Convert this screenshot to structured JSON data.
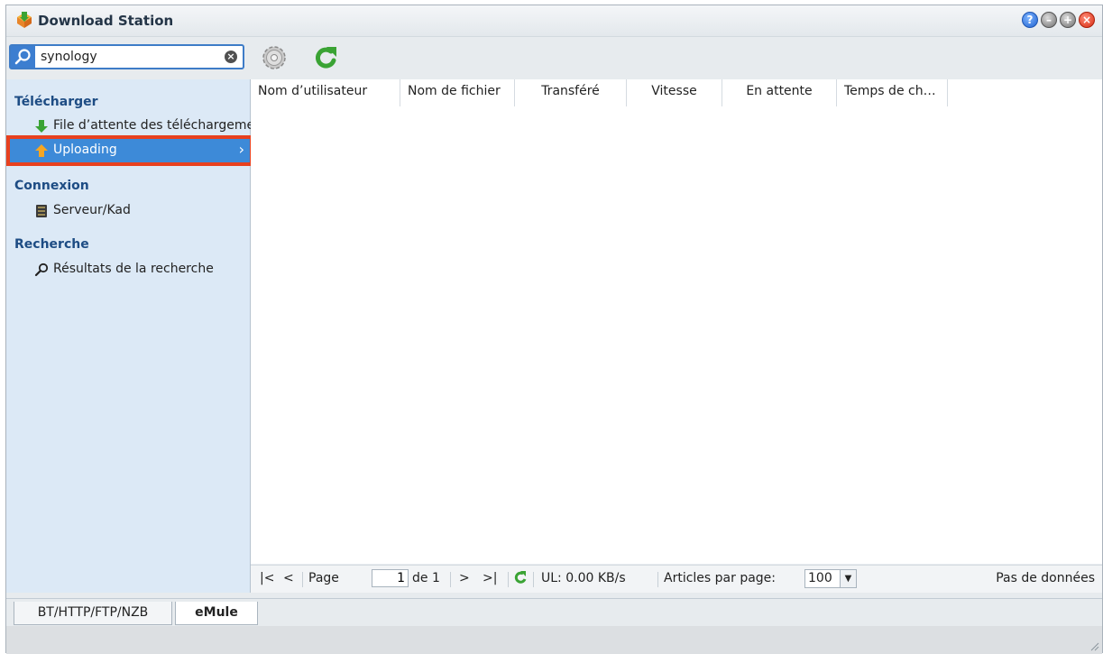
{
  "window": {
    "title": "Download Station"
  },
  "toolbar": {
    "search_value": "synology",
    "settings_label": "Settings",
    "refresh_label": "Refresh"
  },
  "sidebar": {
    "sections": [
      {
        "title": "Télécharger"
      },
      {
        "title": "Connexion"
      },
      {
        "title": "Recherche"
      }
    ],
    "items": [
      {
        "label": "File d’attente des téléchargements",
        "icon": "download-arrow-icon"
      },
      {
        "label": "Uploading",
        "icon": "upload-arrow-icon",
        "selected": true
      },
      {
        "label": "Serveur/Kad",
        "icon": "server-icon"
      },
      {
        "label": "Résultats de la recherche",
        "icon": "search-icon"
      }
    ]
  },
  "table": {
    "columns": [
      "Nom d’utilisateur",
      "Nom de fichier",
      "Transféré",
      "Vitesse",
      "En attente",
      "Temps de ch…"
    ],
    "rows": []
  },
  "pager": {
    "page_label": "Page",
    "page_value": "1",
    "of_label": "de 1",
    "ul_speed": "UL: 0.00 KB/s",
    "per_page_label": "Articles par page:",
    "per_page_value": "100",
    "status": "Pas de données"
  },
  "tabs": [
    "BT/HTTP/FTP/NZB",
    "eMule"
  ],
  "colors": {
    "accent": "#3d8ad8",
    "highlight": "#e8401e",
    "section_title": "#1d4c84"
  }
}
